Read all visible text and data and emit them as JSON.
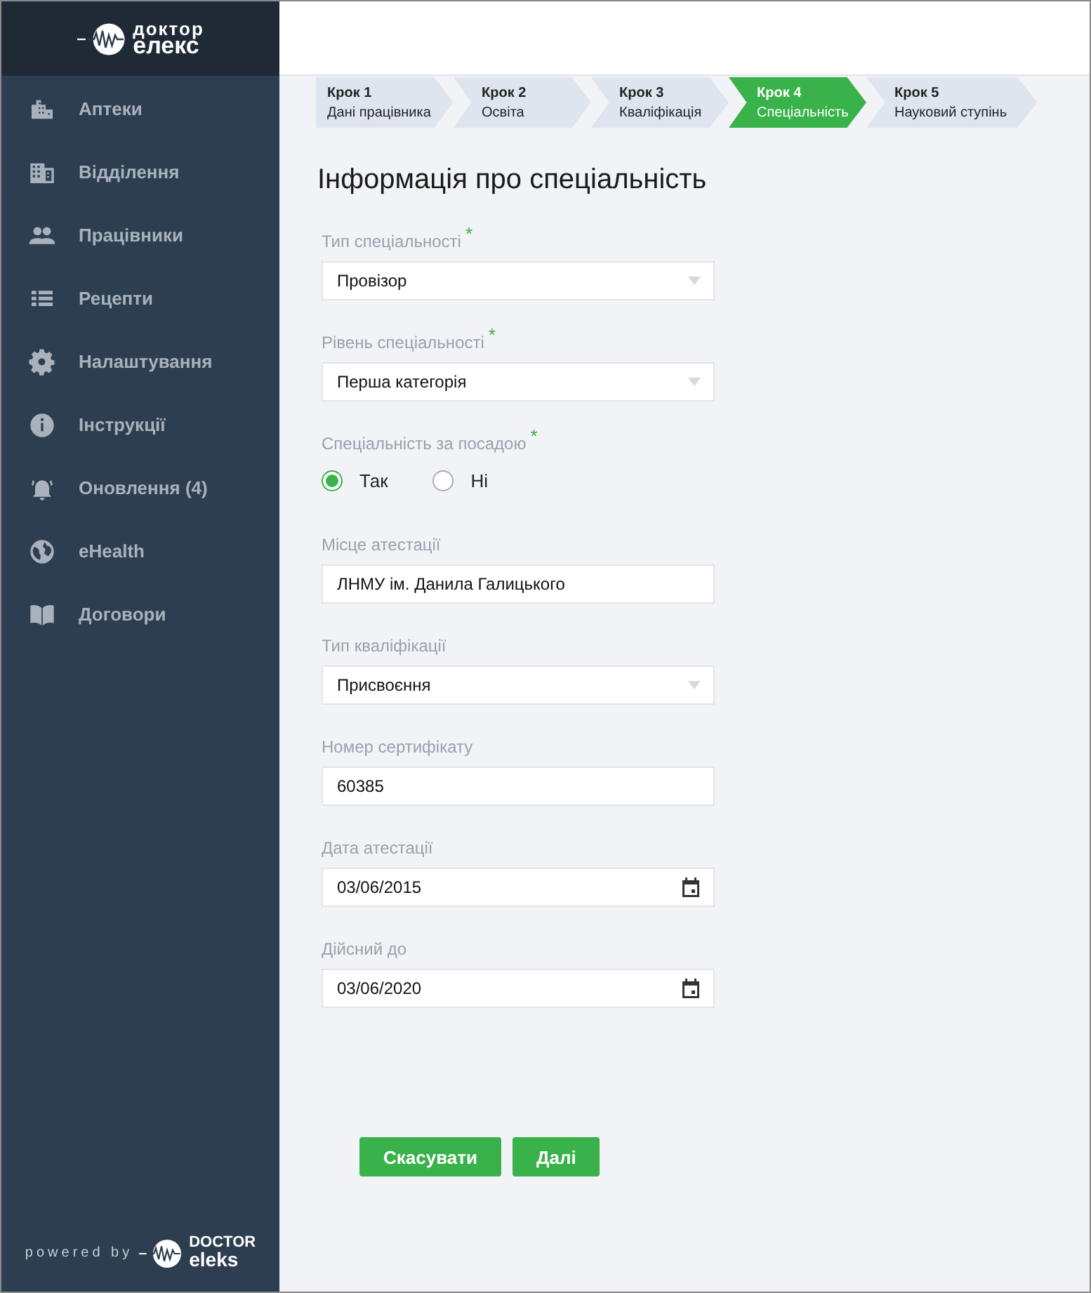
{
  "logo": {
    "line1": "доктор",
    "line2": "елекс"
  },
  "sidebar": {
    "items": [
      {
        "label": "Аптеки"
      },
      {
        "label": "Відділення"
      },
      {
        "label": "Працівники"
      },
      {
        "label": "Рецепти"
      },
      {
        "label": "Налаштування"
      },
      {
        "label": "Інструкції"
      },
      {
        "label": "Оновлення (4)"
      },
      {
        "label": "eHealth"
      },
      {
        "label": "Договори"
      }
    ]
  },
  "footer": {
    "powered_by": "powered by",
    "brand_line1": "DOCTOR",
    "brand_line2": "eleks"
  },
  "steps": [
    {
      "step": "Крок 1",
      "label": "Дані працівника",
      "selected": false
    },
    {
      "step": "Крок 2",
      "label": "Освіта",
      "selected": false
    },
    {
      "step": "Крок 3",
      "label": "Кваліфікація",
      "selected": false
    },
    {
      "step": "Крок 4",
      "label": "Спеціальність",
      "selected": true
    },
    {
      "step": "Крок 5",
      "label": "Науковий ступінь",
      "selected": false
    }
  ],
  "title": "Інформація про спеціальність",
  "fields": [
    {
      "kind": "select",
      "label": "Тип спеціальності",
      "required_mark": "*",
      "value": "Провізор"
    },
    {
      "kind": "select",
      "label": "Рівень спеціальності",
      "required_mark": "*",
      "value": "Перша категорія"
    },
    {
      "kind": "radio",
      "label": "Спеціальність за посадою",
      "required_mark": "*",
      "options": [
        {
          "label": "Так",
          "selected": true
        },
        {
          "label": "Ні",
          "selected": false
        }
      ]
    },
    {
      "kind": "text",
      "label": "Місце атестації",
      "value": "ЛНМУ ім. Данила Галицького"
    },
    {
      "kind": "select",
      "label": "Тип кваліфікації",
      "value": "Присвоєння"
    },
    {
      "kind": "text",
      "label": "Номер сертифікату",
      "value": "60385"
    },
    {
      "kind": "date",
      "label": "Дата атестації",
      "value": "03/06/2015"
    },
    {
      "kind": "date",
      "label": "Дійсний до",
      "value": "03/06/2020"
    }
  ],
  "buttons": [
    "Скасувати",
    "Далі"
  ]
}
